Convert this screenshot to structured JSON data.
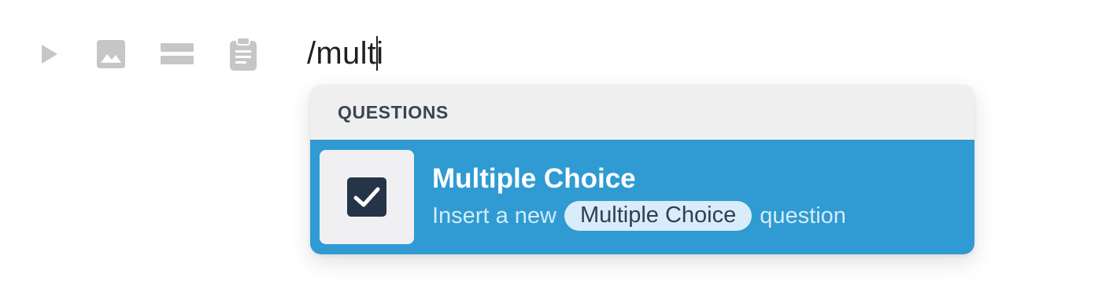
{
  "toolbar": {
    "icons": [
      "play-icon",
      "image-icon",
      "divider-icon",
      "clipboard-icon"
    ]
  },
  "editor": {
    "typed_text": "/multi"
  },
  "menu": {
    "section_label": "QUESTIONS",
    "items": [
      {
        "icon": "checkbox-checked-icon",
        "title": "Multiple Choice",
        "desc_prefix": "Insert a new",
        "desc_tag": "Multiple Choice",
        "desc_suffix": "question",
        "selected": true
      }
    ]
  },
  "colors": {
    "accent": "#2f9bd2",
    "menu_bg": "#efeff0",
    "icon_muted": "#c6c6c6",
    "checkbox": "#263447"
  }
}
